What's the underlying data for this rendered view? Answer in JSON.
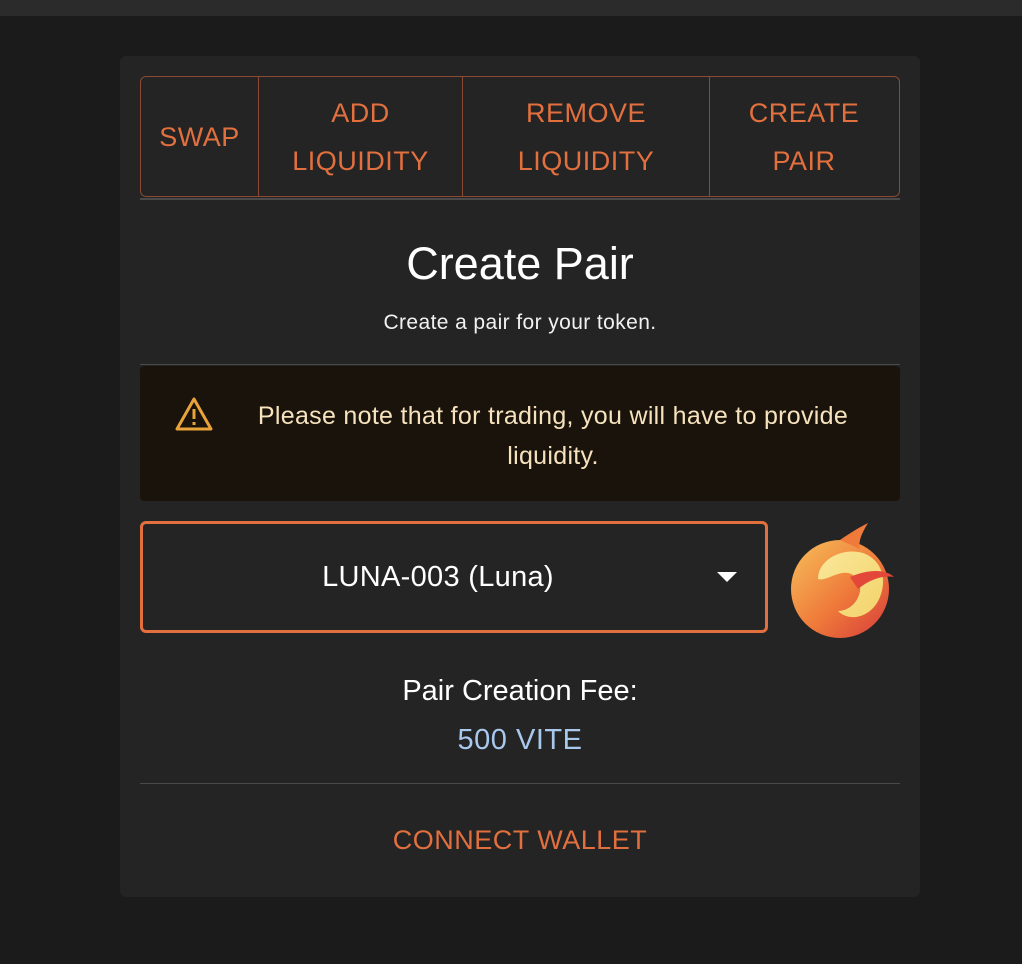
{
  "tabs": [
    {
      "label": "SWAP"
    },
    {
      "label": "ADD\nLIQUIDITY"
    },
    {
      "label": "REMOVE\nLIQUIDITY"
    },
    {
      "label": "CREATE\nPAIR"
    }
  ],
  "page": {
    "title": "Create Pair",
    "subtitle": "Create a pair for your token."
  },
  "alert": {
    "icon": "warning-triangle-icon",
    "text": "Please note that for trading, you will have to provide liquidity."
  },
  "token_select": {
    "value": "LUNA-003 (Luna)",
    "icon": "chevron-down-icon"
  },
  "token_logo": {
    "icon": "luna-token-logo"
  },
  "fee": {
    "label": "Pair Creation Fee:",
    "value": "500 VITE"
  },
  "connect_label": "CONNECT WALLET",
  "colors": {
    "background": "#1b1b1b",
    "card": "#242424",
    "accent": "#e2703f",
    "alert_bg": "#1a130b",
    "alert_text": "#f6e2bd",
    "fee_value": "#a8c8ee"
  }
}
